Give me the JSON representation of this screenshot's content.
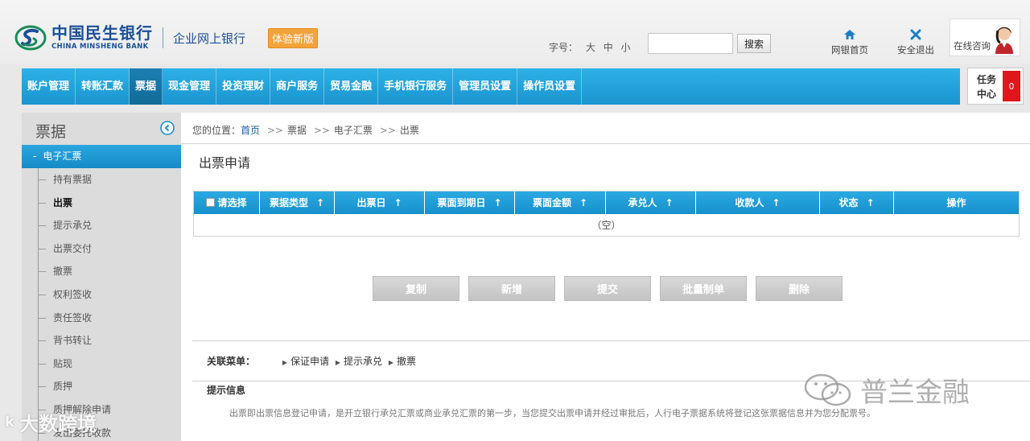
{
  "header": {
    "logo_cn": "中国民生银行",
    "logo_en": "CHINA MINSHENG BANK",
    "logo_sub": "企业网上银行",
    "new_badge": "体验新版",
    "fontsize_label": "字号：",
    "fontsize_options": [
      "大",
      "中",
      "小"
    ],
    "search_placeholder": "",
    "search_button": "搜索",
    "home_link": "网银首页",
    "exit_link": "安全退出",
    "consult_label": "在线咨询"
  },
  "nav": {
    "items": [
      "账户管理",
      "转账汇款",
      "票据",
      "现金管理",
      "投资理财",
      "商户服务",
      "贸易金融",
      "手机银行服务",
      "管理员设置",
      "操作员设置"
    ],
    "active_index": 2
  },
  "task_center": {
    "label": "任务中心",
    "count": "0"
  },
  "sidebar": {
    "title": "票据",
    "group": "电子汇票",
    "group_prefix": "-",
    "items": [
      "持有票据",
      "出票",
      "提示承兑",
      "出票交付",
      "撤票",
      "权利签收",
      "责任签收",
      "背书转让",
      "贴现",
      "质押",
      "质押解除申请",
      "发出委托收款"
    ],
    "active_index": 1
  },
  "breadcrumb": {
    "prefix": "您的位置：",
    "home": "首页",
    "path": [
      "票据",
      "电子汇票",
      "出票"
    ],
    "separator": ">>"
  },
  "page_title": "出票申请",
  "grid": {
    "select_all_label": "请选择",
    "columns": [
      "票据类型",
      "出票日",
      "票面到期日",
      "票面金额",
      "承兑人",
      "收款人",
      "状态",
      "操作"
    ],
    "sortable_arrow": "↑",
    "empty_text": "（空）"
  },
  "buttons": [
    "复制",
    "新增",
    "提交",
    "批量制单",
    "删除"
  ],
  "related": {
    "label": "关联菜单：",
    "links": [
      "保证申请",
      "提示承兑",
      "撤票"
    ]
  },
  "tips": {
    "title": "提示信息",
    "text": "出票即出票信息登记申请，是开立银行承兑汇票或商业承兑汇票的第一步，当您提交出票申请并经过审批后，人行电子票据系统将登记这张票据信息并为您分配票号。"
  },
  "watermarks": {
    "wechat": "普兰金融",
    "platform_logo": "k",
    "platform": "大数跨境"
  },
  "colors": {
    "brand_blue": "#1b4f99",
    "nav_blue": "#1a94cf",
    "badge_orange": "#f3a33b",
    "alert_red": "#e0161b"
  }
}
